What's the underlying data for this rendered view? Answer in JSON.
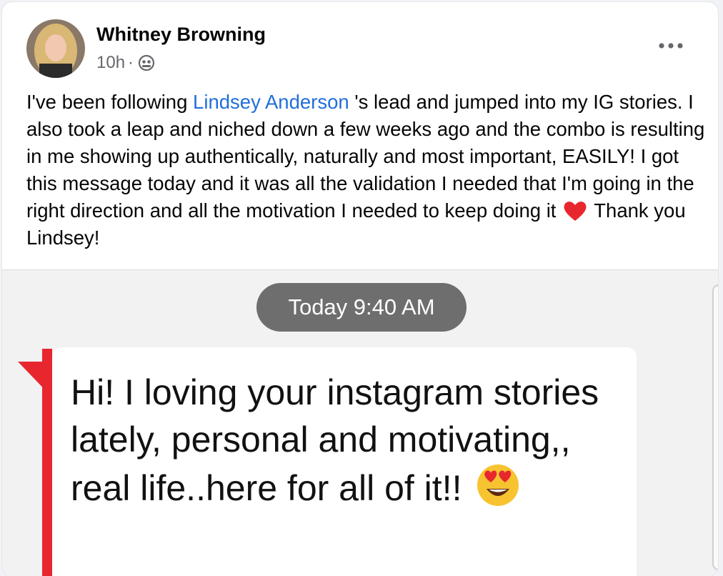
{
  "post": {
    "author": "Whitney Browning",
    "time": "10h",
    "separator": "·",
    "audience_icon": "public-globe-icon",
    "more_icon": "more-options-icon",
    "text_before_mention": "I've been following ",
    "mention": "Lindsey Anderson",
    "text_after_mention": " 's lead and jumped into my IG stories. I also took a leap and niched down a few weeks ago and the combo is resulting in me showing up authentically, naturally and most important, EASILY! I got this message today and it was all the validation I needed that I'm going in the right direction and all the motivation I needed to keep doing it ",
    "heart_icon": "red-heart-emoji",
    "text_end": " Thank you Lindsey!"
  },
  "screenshot": {
    "timestamp": "Today 9:40 AM",
    "message": "Hi! I loving your instagram stories lately, personal and motivating,, real life..here for all of it!! ",
    "emoji_icon": "heart-eyes-emoji"
  },
  "colors": {
    "mention": "#216fdb",
    "text": "#050505",
    "meta": "#65676b",
    "accent_red": "#e8262e",
    "bubble_timestamp": "#6e6e6e"
  }
}
